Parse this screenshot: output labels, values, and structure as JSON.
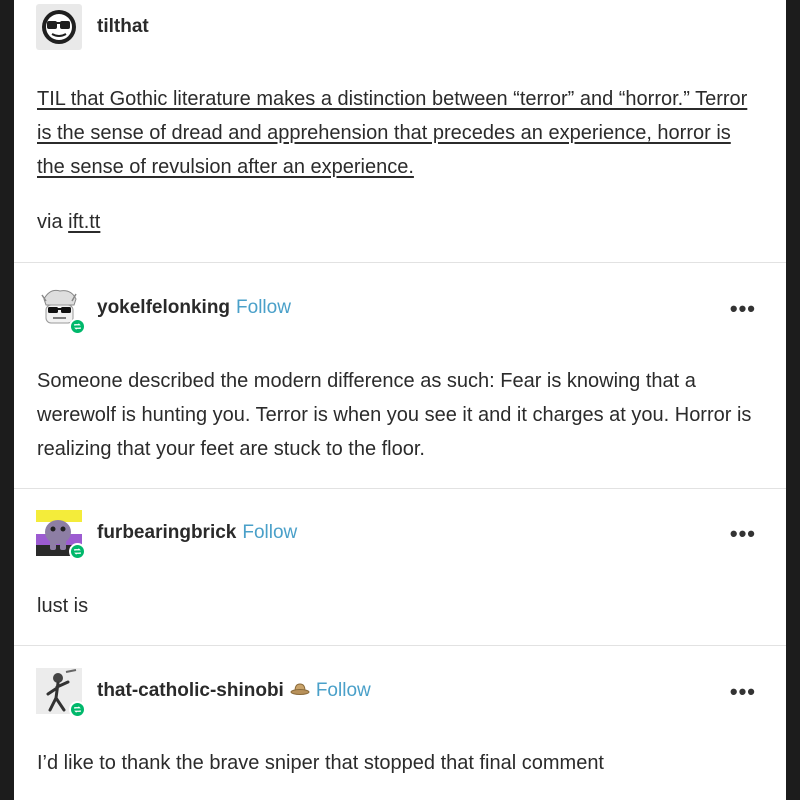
{
  "posts": [
    {
      "username": "tilthat",
      "avatar_icon": "sunglasses-face-icon",
      "text": "TIL that Gothic literature makes a distinction between “terror” and “horror.” Terror is the sense of dread and apprehension that precedes an experience, horror is the sense of revulsion after an experience.",
      "via_label": "via",
      "via_link": "ift.tt"
    },
    {
      "username": "yokelfelonking",
      "follow_label": "Follow",
      "avatar_icon": "sunglasses-character-avatar-icon",
      "more_label": "•••",
      "text": "Someone described the modern difference as such:  Fear is knowing that a werewolf is hunting you.  Terror is when you see it and it charges at you.  Horror is realizing that your feet are stuck to the floor."
    },
    {
      "username": "furbearingbrick",
      "follow_label": "Follow",
      "avatar_icon": "creature-on-flag-avatar-icon",
      "more_label": "•••",
      "text": "lust is"
    },
    {
      "username": "that-catholic-shinobi",
      "follow_label": "Follow",
      "avatar_icon": "ninja-figure-avatar-icon",
      "badge_icon": "hat-icon",
      "more_label": "•••",
      "text": "I’d like to thank the brave sniper that stopped that final comment"
    }
  ],
  "colors": {
    "background": "#1c1c1c",
    "card": "#ffffff",
    "follow": "#4aa0c9",
    "reblog_badge": "#00b86b",
    "divider": "#e2e2e2"
  }
}
